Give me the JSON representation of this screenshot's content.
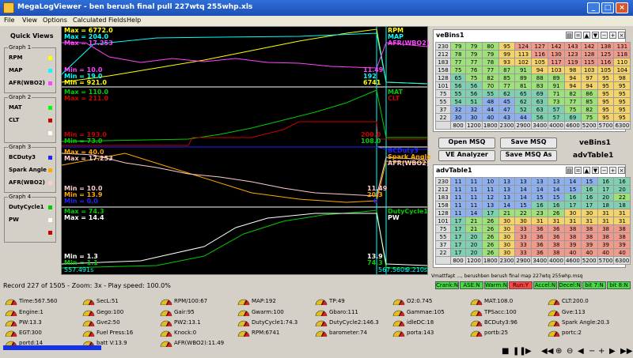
{
  "window": {
    "title": "MegaLogViewer - ben berush final pull 227wtq 255whp.xls"
  },
  "menu": [
    "File",
    "View",
    "Options",
    "Calculated Fields",
    "Help"
  ],
  "sidebar": {
    "quick_views": "Quick Views",
    "groups": [
      {
        "label": "Graph 1",
        "channels": [
          {
            "name": "RPM",
            "color": "#ffff00"
          },
          {
            "name": "MAP",
            "color": "#00ffff"
          },
          {
            "name": "AFR(WBO2)",
            "color": "#ff44ff"
          }
        ]
      },
      {
        "label": "Graph 2",
        "channels": [
          {
            "name": "MAT",
            "color": "#00ff00"
          },
          {
            "name": "CLT",
            "color": "#cc0000"
          },
          {
            "name": "",
            "color": "#ffffff"
          }
        ]
      },
      {
        "label": "Graph 3",
        "channels": [
          {
            "name": "BCDuty3",
            "color": "#2222ff"
          },
          {
            "name": "Spark Angle",
            "color": "#ffaa00"
          },
          {
            "name": "AFR(WBO2)",
            "color": "#ffcccc"
          }
        ]
      },
      {
        "label": "Graph 4",
        "channels": [
          {
            "name": "DutyCycle1",
            "color": "#00cc00"
          },
          {
            "name": "PW",
            "color": "#ffffff"
          },
          {
            "name": "",
            "color": "#cc0000"
          }
        ]
      }
    ]
  },
  "chart": {
    "g1": {
      "max": [
        "Max = 6772.0",
        "Max = 204.0",
        "Max = 17.253"
      ],
      "min": [
        "Min = 10.0",
        "Min = 19.0",
        "Min = 921.0"
      ],
      "cursor": [
        "RPM",
        "MAP",
        "AFR(WBO2)"
      ],
      "vals": [
        "11.49",
        "192",
        "6741"
      ]
    },
    "g2": {
      "max": [
        "Max = 110.0",
        "Max = 211.0"
      ],
      "min": [
        "Min = 193.0",
        "Min = 73.0"
      ],
      "cursor": [
        "MAT",
        "CLT"
      ],
      "vals": [
        "200.0",
        "108.0"
      ]
    },
    "g3": {
      "max": [
        "Max = 40.0",
        "Max = 17.253"
      ],
      "min": [
        "Min = 10.0",
        "Min = 13.9",
        "Min = 0.0"
      ],
      "cursor": [
        "BCDuty3",
        "Spark Angle",
        "AFR(WBO2)"
      ],
      "vals": [
        "11.49",
        "20.3",
        "0"
      ]
    },
    "g4": {
      "max": [
        "Max = 74.3",
        "Max = 14.4"
      ],
      "min": [
        "Min = 1.3",
        "Min = 1.1"
      ],
      "cursor": [
        "DutyCycle1",
        "PW"
      ],
      "vals": [
        "13.9",
        "74.3"
      ]
    },
    "time_left": "557.491s",
    "time_right": "567.560s",
    "time_right2": "9.210s"
  },
  "status": {
    "record": "Record 227 of 1505 - Zoom: 3x - Play speed: 100.0%",
    "msq": "Vmattfapt ..., berushben berush final map 227wtq 255whp.msq"
  },
  "flags": [
    {
      "label": "Crank:N",
      "color": "#44dd44"
    },
    {
      "label": "ASE:N",
      "color": "#44dd44"
    },
    {
      "label": "Warm:N",
      "color": "#44dd44"
    },
    {
      "label": "Run:Y",
      "color": "#ff4444"
    },
    {
      "label": "Accel:N",
      "color": "#44dd44"
    },
    {
      "label": "Decel:N",
      "color": "#44dd44"
    },
    {
      "label": "bit 7:N",
      "color": "#44dd44"
    },
    {
      "label": "bit 8:N",
      "color": "#44dd44"
    }
  ],
  "gauges": [
    [
      "Time:567.560",
      "SecL:51",
      "RPM/100:67",
      "MAP:192",
      "TP:49",
      "O2:0.745",
      "MAT:108.0",
      "CLT:200.0"
    ],
    [
      "Engine:1",
      "Gego:100",
      "Gair:95",
      "Gwarm:100",
      "Gbaro:111",
      "Gammae:105",
      "TPSacc:100",
      "Gve:113"
    ],
    [
      "PW:13.3",
      "Gve2:50",
      "PW2:13.1",
      "DutyCycle1:74.3",
      "DutyCycle2:146.3",
      "idleDC:18",
      "BCDuty3:96",
      "Spark Angle:20.3"
    ],
    [
      "EGT:300",
      "Fuel Press:16",
      "Knock:0",
      "RPM:6741",
      "barometer:74",
      "porta:143",
      "portb:25",
      "portc:2"
    ],
    [
      "portd:14",
      "batt V:13.9",
      "AFR(WBO2):11.49"
    ]
  ],
  "ve_table": {
    "title": "veBins1",
    "side_label": "veBins1",
    "rows": [
      "230",
      "212",
      "183",
      "158",
      "128",
      "101",
      "75",
      "55",
      "37",
      "22"
    ],
    "cols": [
      "800",
      "1200",
      "1800",
      "2300",
      "2900",
      "3400",
      "4000",
      "4600",
      "5200",
      "5700",
      "6300",
      "7000"
    ],
    "cells": [
      [
        "79",
        "79",
        "80",
        "95",
        "124",
        "127",
        "142",
        "143",
        "142",
        "138",
        "131"
      ],
      [
        "78",
        "79",
        "79",
        "99",
        "113",
        "116",
        "130",
        "123",
        "128",
        "125",
        "118"
      ],
      [
        "77",
        "77",
        "78",
        "93",
        "102",
        "105",
        "117",
        "119",
        "115",
        "116",
        "110"
      ],
      [
        "75",
        "76",
        "77",
        "87",
        "91",
        "94",
        "103",
        "98",
        "103",
        "105",
        "104"
      ],
      [
        "65",
        "75",
        "82",
        "85",
        "89",
        "88",
        "89",
        "94",
        "97",
        "95",
        "98"
      ],
      [
        "56",
        "56",
        "70",
        "77",
        "81",
        "83",
        "91",
        "94",
        "94",
        "95",
        "95"
      ],
      [
        "55",
        "56",
        "55",
        "62",
        "65",
        "69",
        "71",
        "82",
        "86",
        "95",
        "95"
      ],
      [
        "54",
        "51",
        "48",
        "45",
        "62",
        "63",
        "73",
        "77",
        "85",
        "95",
        "95"
      ],
      [
        "32",
        "32",
        "44",
        "47",
        "52",
        "63",
        "57",
        "75",
        "82",
        "95",
        "95"
      ],
      [
        "30",
        "30",
        "40",
        "43",
        "44",
        "56",
        "57",
        "69",
        "75",
        "95",
        "95"
      ]
    ]
  },
  "adv_table": {
    "title": "advTable1",
    "side_label": "advTable1",
    "rows": [
      "230",
      "212",
      "183",
      "158",
      "128",
      "101",
      "75",
      "55",
      "37",
      "22"
    ],
    "cols": [
      "800",
      "1200",
      "1800",
      "2300",
      "2900",
      "3400",
      "4000",
      "4600",
      "5200",
      "5700",
      "6300",
      "7000"
    ],
    "cells": [
      [
        "11",
        "11",
        "10",
        "13",
        "13",
        "13",
        "13",
        "14",
        "15",
        "16",
        "16"
      ],
      [
        "11",
        "11",
        "11",
        "13",
        "14",
        "14",
        "14",
        "15",
        "16",
        "17",
        "20"
      ],
      [
        "11",
        "11",
        "12",
        "13",
        "14",
        "15",
        "15",
        "16",
        "16",
        "20",
        "22"
      ],
      [
        "11",
        "11",
        "13",
        "14",
        "15",
        "16",
        "16",
        "17",
        "17",
        "18",
        "18"
      ],
      [
        "11",
        "14",
        "17",
        "21",
        "22",
        "23",
        "26",
        "30",
        "30",
        "31",
        "31"
      ],
      [
        "17",
        "21",
        "26",
        "30",
        "30",
        "31",
        "31",
        "31",
        "31",
        "31",
        "31"
      ],
      [
        "17",
        "21",
        "26",
        "30",
        "33",
        "36",
        "36",
        "38",
        "38",
        "38",
        "38"
      ],
      [
        "17",
        "20",
        "26",
        "30",
        "33",
        "36",
        "36",
        "38",
        "38",
        "38",
        "38"
      ],
      [
        "17",
        "20",
        "26",
        "30",
        "33",
        "36",
        "38",
        "39",
        "39",
        "39",
        "39"
      ],
      [
        "17",
        "20",
        "26",
        "30",
        "33",
        "36",
        "38",
        "40",
        "40",
        "40",
        "40"
      ]
    ]
  },
  "buttons": {
    "open": "Open MSQ",
    "save": "Save MSQ",
    "analyzer": "VE Analyzer",
    "saveas": "Save MSQ As"
  }
}
